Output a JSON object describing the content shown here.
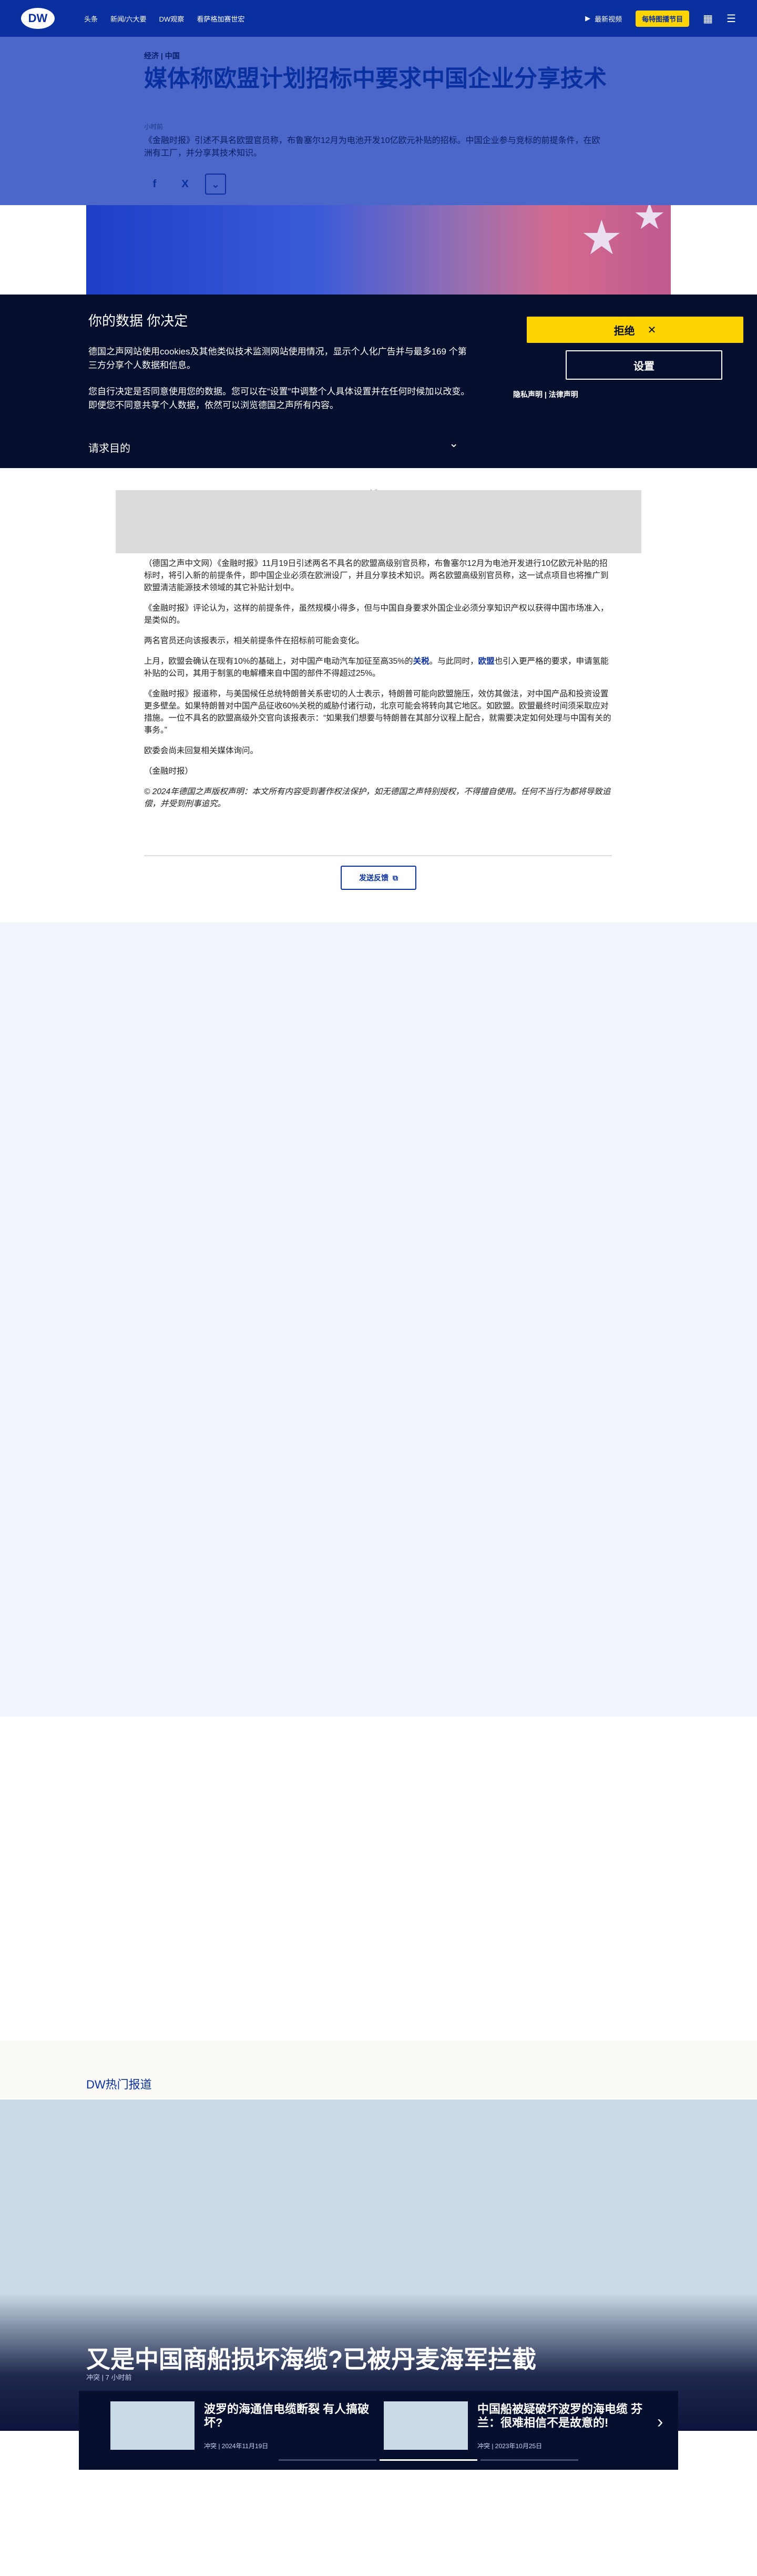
{
  "header": {
    "logo": "DW",
    "nav": [
      "头条",
      "新闻/六大要",
      "DW观察",
      "看萨格加赛世宏"
    ],
    "live": "最新视频",
    "promo": "每特图播节目"
  },
  "article": {
    "kicker": "经济 | 中国",
    "title": "媒体称欧盟计划招标中要求中国企业分享技术",
    "date": "小时前",
    "lead": "《金融时报》引述不具名欧盟官员称，布鲁塞尔12月为电池开发10亿欧元补贴的招标。中国企业参与竞标的前提条件，在欧洲有工厂，并分享其技术知识。",
    "share": {
      "facebook": "f",
      "x": "X",
      "more": "⌄"
    }
  },
  "consent": {
    "title": "你的数据 你决定",
    "p1": "德国之声网站使用cookies及其他类似技术监测网站使用情况，显示个人化广告并与最多169 个第三方分享个人数据和信息。",
    "p2": "您自行决定是否同意使用您的数据。您可以在“设置”中调整个人具体设置并在任何时候加以改变。即便您不同意共享个人数据，依然可以浏览德国之声所有内容。",
    "purpose": "请求目的",
    "reject": "拒绝",
    "settings": "设置",
    "links": "隐私声明 | 法律声明"
  },
  "ad_label": "广告",
  "body": {
    "p1": "（德国之声中文网）《金融时报》11月19日引述两名不具名的欧盟高级别官员称，布鲁塞尔12月为电池开发进行10亿欧元补贴的招标时，将引入新的前提条件，即中国企业必须在欧洲设厂，并且分享技术知识。两名欧盟高级别官员称，这一试点项目也将推广到欧盟清洁能源技术领域的其它补贴计划中。",
    "p2": "《金融时报》评论认为，这样的前提条件，虽然规模小得多，但与中国自身要求外国企业必须分享知识产权以获得中国市场准入，是类似的。",
    "p3": "两名官员还向该报表示，相关前提条件在招标前可能会变化。",
    "p4a": "上月，欧盟会确认在现有10%的基础上，对中国产电动汽车加征至高35%的",
    "p4_link1": "关税",
    "p4b": "。与此同时，",
    "p4_link2": "欧盟",
    "p4c": "也引入更严格的要求，申请氢能补贴的公司，其用于制氢的电解槽来自中国的部件不得超过25%。",
    "p5": "《金融时报》报道称，与美国候任总统特朗普关系密切的人士表示，特朗普可能向欧盟施压，效仿其做法，对中国产品和投资设置更多壁垒。如果特朗普对中国产品征收60%关税的威胁付诸行动，北京可能会将转向其它地区。如欧盟。欧盟最终时间须采取应对措施。一位不具名的欧盟高级外交官向该报表示：“如果我们想要与特朗普在其部分议程上配合，就需要决定如何处理与中国有关的事务。”",
    "p6": "欧委会尚未回复相关媒体询问。",
    "p7": "（金融时报）",
    "copyright": "© 2024年德国之声版权声明：本文所有内容受到著作权法保护，如无德国之声特别授权，不得擅自使用。任何不当行为都将导致追偿，并受到刑事追究。",
    "feedback": "发送反馈"
  },
  "hot": {
    "label": "DW热门报道",
    "title": "又是中国商船损坏海缆?已被丹麦海军拦截",
    "meta": "冲突 | 7 小时前",
    "cards": [
      {
        "title": "波罗的海通信电缆断裂 有人搞破坏?",
        "meta": "冲突 | 2024年11月19日"
      },
      {
        "title": "中国船被疑破坏波罗的海电缆 芬兰：很难相信不是故意的!",
        "meta": "冲突 | 2023年10月25日"
      }
    ],
    "next": "›"
  }
}
